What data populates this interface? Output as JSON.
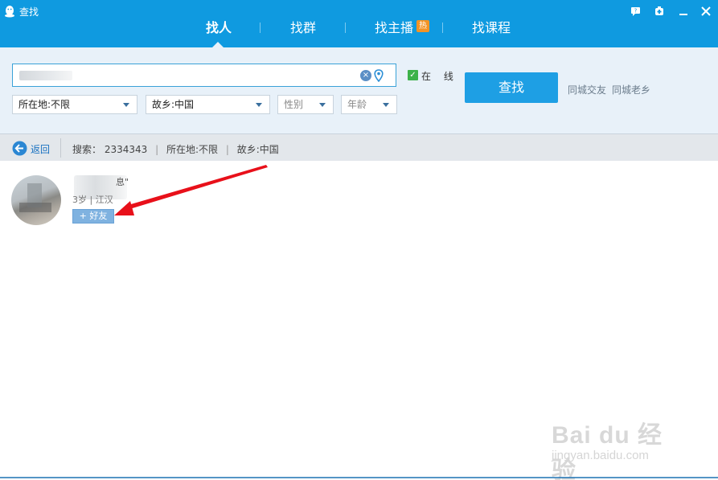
{
  "window": {
    "title": "查找",
    "controls": [
      "feedback-icon",
      "skin-icon",
      "minimize-icon",
      "close-icon"
    ]
  },
  "tabs": [
    {
      "label": "找人",
      "active": true
    },
    {
      "label": "找群",
      "active": false
    },
    {
      "label": "找主播",
      "active": false,
      "badge": "热"
    },
    {
      "label": "找课程",
      "active": false
    }
  ],
  "search": {
    "online_label": "在 线",
    "online_checked": true,
    "location_select": "所在地:不限",
    "hometown_select": "故乡:中国",
    "gender_select": "性别",
    "age_select": "年龄",
    "search_button": "查找",
    "quick_links": [
      "同城交友",
      "同城老乡"
    ]
  },
  "result_bar": {
    "back_label": "返回",
    "criteria_label": "搜索：",
    "criteria_id": "2334343",
    "criteria_location": "所在地:不限",
    "criteria_hometown": "故乡:中国"
  },
  "results": [
    {
      "name_suffix": "息\"",
      "info": "3岁 | 江汉",
      "add_button": "+ 好友"
    }
  ],
  "watermark": {
    "main": "Bai du 经验",
    "sub": "jingyan.baidu.com"
  },
  "colors": {
    "titlebar": "#0f9ae0",
    "panel": "#e8f1f9",
    "button": "#1e9fe4",
    "arrow": "#e8101a"
  }
}
